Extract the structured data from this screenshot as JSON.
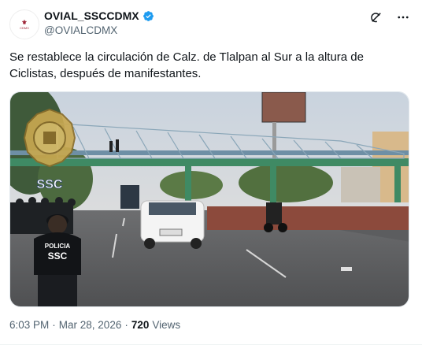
{
  "author": {
    "display_name": "OVIAL_SSCCDMX",
    "handle": "@OVIALCDMX",
    "avatar_text": "CDMX",
    "verified": true
  },
  "actions": {
    "grok_icon": "grok-icon",
    "more_icon": "more-icon"
  },
  "tweet": {
    "text": "Se restablece la circulación de Calz. de Tlalpan al Sur a la altura de Ciclistas, después de manifestantes."
  },
  "media": {
    "watermark_text": "SSC",
    "vest_line1": "POLICIA",
    "vest_line2": "SSC"
  },
  "meta": {
    "time": "6:03 PM",
    "separator": "·",
    "date": "Mar 28, 2026",
    "separator2": "·",
    "views_count": "720",
    "views_label": "Views"
  },
  "colors": {
    "verified": "#1d9bf0",
    "muted": "#536471",
    "text": "#0f1419"
  }
}
